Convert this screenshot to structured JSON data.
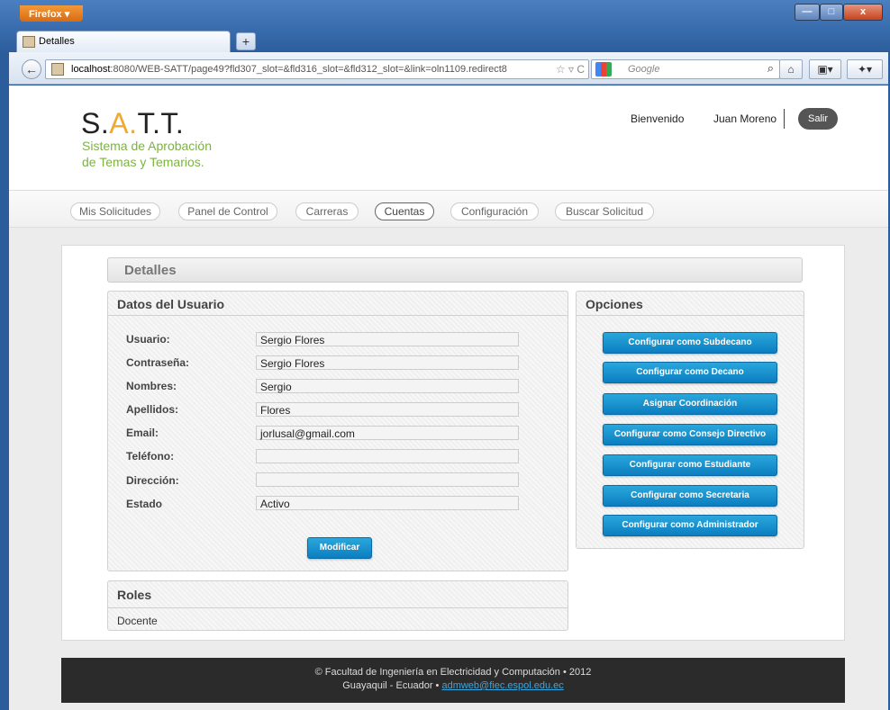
{
  "browser": {
    "app_button": "Firefox ▾",
    "tab_title": "Detalles",
    "new_tab": "+",
    "url_host": "localhost",
    "url_rest": ":8080/WEB-SATT/page49?fld307_slot=&fld316_slot=&fld312_slot=&link=oln1109.redirect8",
    "search_placeholder": "Google",
    "controls": {
      "minimize": "—",
      "maximize": "□",
      "close": "x"
    }
  },
  "header": {
    "logo": {
      "s": "S",
      "dot1": ".",
      "a": "A",
      "dot2": ".",
      "t1": "T.",
      "t2": "T."
    },
    "tagline1": "Sistema de Aprobación",
    "tagline2": "de Temas y Temarios.",
    "welcome": "Bienvenido",
    "user_name": "Juan Moreno",
    "logout": "Salir"
  },
  "menu": {
    "items": [
      "Mis Solicitudes",
      "Panel de Control",
      "Carreras",
      "Cuentas",
      "Configuración",
      "Buscar Solicitud"
    ],
    "active": "Cuentas"
  },
  "page": {
    "title": "Detalles",
    "datos": {
      "title": "Datos del Usuario",
      "fields": [
        {
          "label": "Usuario:",
          "value": "Sergio Flores"
        },
        {
          "label": "Contraseña:",
          "value": "Sergio Flores"
        },
        {
          "label": "Nombres:",
          "value": "Sergio"
        },
        {
          "label": "Apellidos:",
          "value": "Flores"
        },
        {
          "label": "Email:",
          "value": "jorlusal@gmail.com"
        },
        {
          "label": "Teléfono:",
          "value": ""
        },
        {
          "label": "Dirección:",
          "value": ""
        },
        {
          "label": "Estado",
          "value": "Activo"
        }
      ],
      "submit": "Modificar"
    },
    "opciones": {
      "title": "Opciones",
      "buttons": [
        "Configurar como Subdecano",
        "Configurar como Decano",
        "Asignar Coordinación",
        "Configurar como Consejo Directivo",
        "Configurar como Estudiante",
        "Configurar como Secretaria",
        "Configurar como Administrador"
      ]
    },
    "roles": {
      "title": "Roles",
      "items": [
        "Docente"
      ]
    }
  },
  "footer": {
    "line1": "© Facultad de Ingeniería en Electricidad y Computación • 2012",
    "line2_prefix": "Guayaquil - Ecuador • ",
    "email": "admweb@fiec.espol.edu.ec"
  },
  "colors": {
    "accent": "#0b7ec0",
    "tagline": "#7cb342",
    "logo_dot": "#f0a830",
    "footer_bg": "#2b2b2b"
  }
}
